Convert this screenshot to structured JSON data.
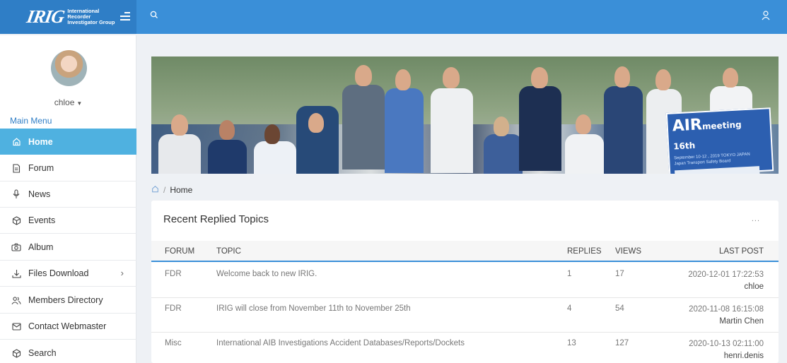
{
  "header": {
    "logo_mark": "IRIG",
    "logo_lines": [
      "International",
      "Recorder",
      "Investigator Group"
    ]
  },
  "sidebar": {
    "user_name": "chloe",
    "section_label": "Main Menu",
    "items": [
      {
        "label": "Home",
        "icon": "home-icon"
      },
      {
        "label": "Forum",
        "icon": "document-icon"
      },
      {
        "label": "News",
        "icon": "microphone-icon"
      },
      {
        "label": "Events",
        "icon": "cube-icon"
      },
      {
        "label": "Album",
        "icon": "camera-icon"
      },
      {
        "label": "Files Download",
        "icon": "download-icon"
      },
      {
        "label": "Members Directory",
        "icon": "members-icon"
      },
      {
        "label": "Contact Webmaster",
        "icon": "mail-icon"
      },
      {
        "label": "Search",
        "icon": "cube-icon"
      }
    ]
  },
  "banner": {
    "poster_title": "AIR",
    "poster_title_rest": "meeting 16th",
    "poster_sub": "September 10-12 , 2019 TOKYO JAPAN",
    "poster_org": "Japan Transport Safety Board"
  },
  "breadcrumb": {
    "current": "Home"
  },
  "topics": {
    "title": "Recent Replied Topics",
    "more": "...",
    "columns": [
      "FORUM",
      "TOPIC",
      "REPLIES",
      "VIEWS",
      "LAST POST"
    ],
    "rows": [
      {
        "forum": "FDR",
        "topic": "Welcome back to new IRIG.",
        "replies": "1",
        "views": "17",
        "date": "2020-12-01 17:22:53",
        "user": "chloe"
      },
      {
        "forum": "FDR",
        "topic": "IRIG will close from November 11th to November 25th",
        "replies": "4",
        "views": "54",
        "date": "2020-11-08 16:15:08",
        "user": "Martin Chen"
      },
      {
        "forum": "Misc",
        "topic": "International AIB Investigations Accident Databases/Reports/Dockets",
        "replies": "13",
        "views": "127",
        "date": "2020-10-13 02:11:00",
        "user": "henri.denis"
      }
    ]
  },
  "colors": {
    "topbar": "#3a8fd8",
    "brand": "#2f7ec6",
    "active_item": "#4fb1e0"
  }
}
